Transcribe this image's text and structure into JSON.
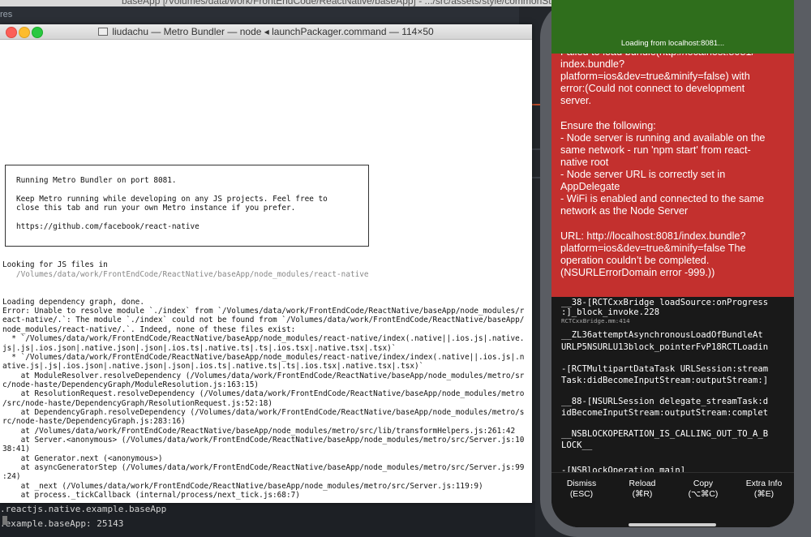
{
  "editor": {
    "top_path": "baseApp [/Volumes/data/work/FrontEndCode/ReactNative/baseApp] - .../src/assets/style/commonStyles.js",
    "tab_fragment": "res",
    "log_lines": [
      ".reactjs.native.example.baseApp",
      ".example.baseApp: 25143"
    ]
  },
  "terminal": {
    "title": "liudachu — Metro Bundler — node ◂ launchPackager.command — 114×50",
    "banner": [
      "Running Metro Bundler on port 8081.",
      "Keep Metro running while developing on any JS projects. Feel free to",
      "close this tab and run your own Metro instance if you prefer.",
      "https://github.com/facebook/react-native"
    ],
    "looking": "Looking for JS files in",
    "looking_path": "   /Volumes/data/work/FrontEndCode/ReactNative/baseApp/node_modules/react-native",
    "lines": [
      "Loading dependency graph, done.",
      "Error: Unable to resolve module `./index` from `/Volumes/data/work/FrontEndCode/ReactNative/baseApp/node_modules/r",
      "eact-native/.`: The module `./index` could not be found from `/Volumes/data/work/FrontEndCode/ReactNative/baseApp/",
      "node_modules/react-native/.`. Indeed, none of these files exist:",
      "  * `/Volumes/data/work/FrontEndCode/ReactNative/baseApp/node_modules/react-native/index(.native||.ios.js|.native.",
      "js|.js|.ios.json|.native.json|.json|.ios.ts|.native.ts|.ts|.ios.tsx|.native.tsx|.tsx)`",
      "  * `/Volumes/data/work/FrontEndCode/ReactNative/baseApp/node_modules/react-native/index/index(.native||.ios.js|.n",
      "ative.js|.js|.ios.json|.native.json|.json|.ios.ts|.native.ts|.ts|.ios.tsx|.native.tsx|.tsx)`",
      "    at ModuleResolver.resolveDependency (/Volumes/data/work/FrontEndCode/ReactNative/baseApp/node_modules/metro/sr",
      "c/node-haste/DependencyGraph/ModuleResolution.js:163:15)",
      "    at ResolutionRequest.resolveDependency (/Volumes/data/work/FrontEndCode/ReactNative/baseApp/node_modules/metro",
      "/src/node-haste/DependencyGraph/ResolutionRequest.js:52:18)",
      "    at DependencyGraph.resolveDependency (/Volumes/data/work/FrontEndCode/ReactNative/baseApp/node_modules/metro/s",
      "rc/node-haste/DependencyGraph.js:283:16)",
      "    at /Volumes/data/work/FrontEndCode/ReactNative/baseApp/node_modules/metro/src/lib/transformHelpers.js:261:42",
      "    at Server.<anonymous> (/Volumes/data/work/FrontEndCode/ReactNative/baseApp/node_modules/metro/src/Server.js:10",
      "38:41)",
      "    at Generator.next (<anonymous>)",
      "    at asyncGeneratorStep (/Volumes/data/work/FrontEndCode/ReactNative/baseApp/node_modules/metro/src/Server.js:99",
      ":24)",
      "    at _next (/Volumes/data/work/FrontEndCode/ReactNative/baseApp/node_modules/metro/src/Server.js:119:9)",
      "    at process._tickCallback (internal/process/next_tick.js:68:7)"
    ]
  },
  "phone": {
    "loading_text": "Loading from localhost:8081...",
    "red_lines": [
      "Failed to load bundle(http://localhost:8081/",
      "index.bundle?",
      "platform=ios&dev=true&minify=false) with",
      "error:(Could not connect to development",
      "server.",
      "",
      "Ensure the following:",
      "- Node server is running and available on the",
      "same network - run 'npm start' from react-",
      "native root",
      "- Node server URL is correctly set in",
      "AppDelegate",
      "- WiFi is enabled and connected to the same",
      "network as the Node Server",
      "",
      "URL: http://localhost:8081/index.bundle?",
      "platform=ios&dev=true&minify=false The",
      "operation couldn’t be completed.",
      "(NSURLErrorDomain error -999.))"
    ],
    "stack": [
      "__38-[RCTCxxBridge loadSource:onProgress",
      ":]_block_invoke.228",
      "RCTCxxBridge.mm:414",
      "__ZL36attemptAsynchronousLoadOfBundleAt",
      "URLP5NSURLU13block_pointerFvP18RCTLoadin",
      "-[RCTMultipartDataTask URLSession:stream",
      "Task:didBecomeInputStream:outputStream:]",
      "__88-[NSURLSession delegate_streamTask:d",
      "idBecomeInputStream:outputStream:complet",
      "__NSBLOCKOPERATION_IS_CALLING_OUT_TO_A_B",
      "LOCK__",
      "-[NSBlockOperation main]"
    ],
    "actions": [
      {
        "label": "Dismiss",
        "key": "(ESC)"
      },
      {
        "label": "Reload",
        "key": "(⌘R)"
      },
      {
        "label": "Copy",
        "key": "(⌥⌘C)"
      },
      {
        "label": "Extra Info",
        "key": "(⌘E)"
      }
    ]
  }
}
